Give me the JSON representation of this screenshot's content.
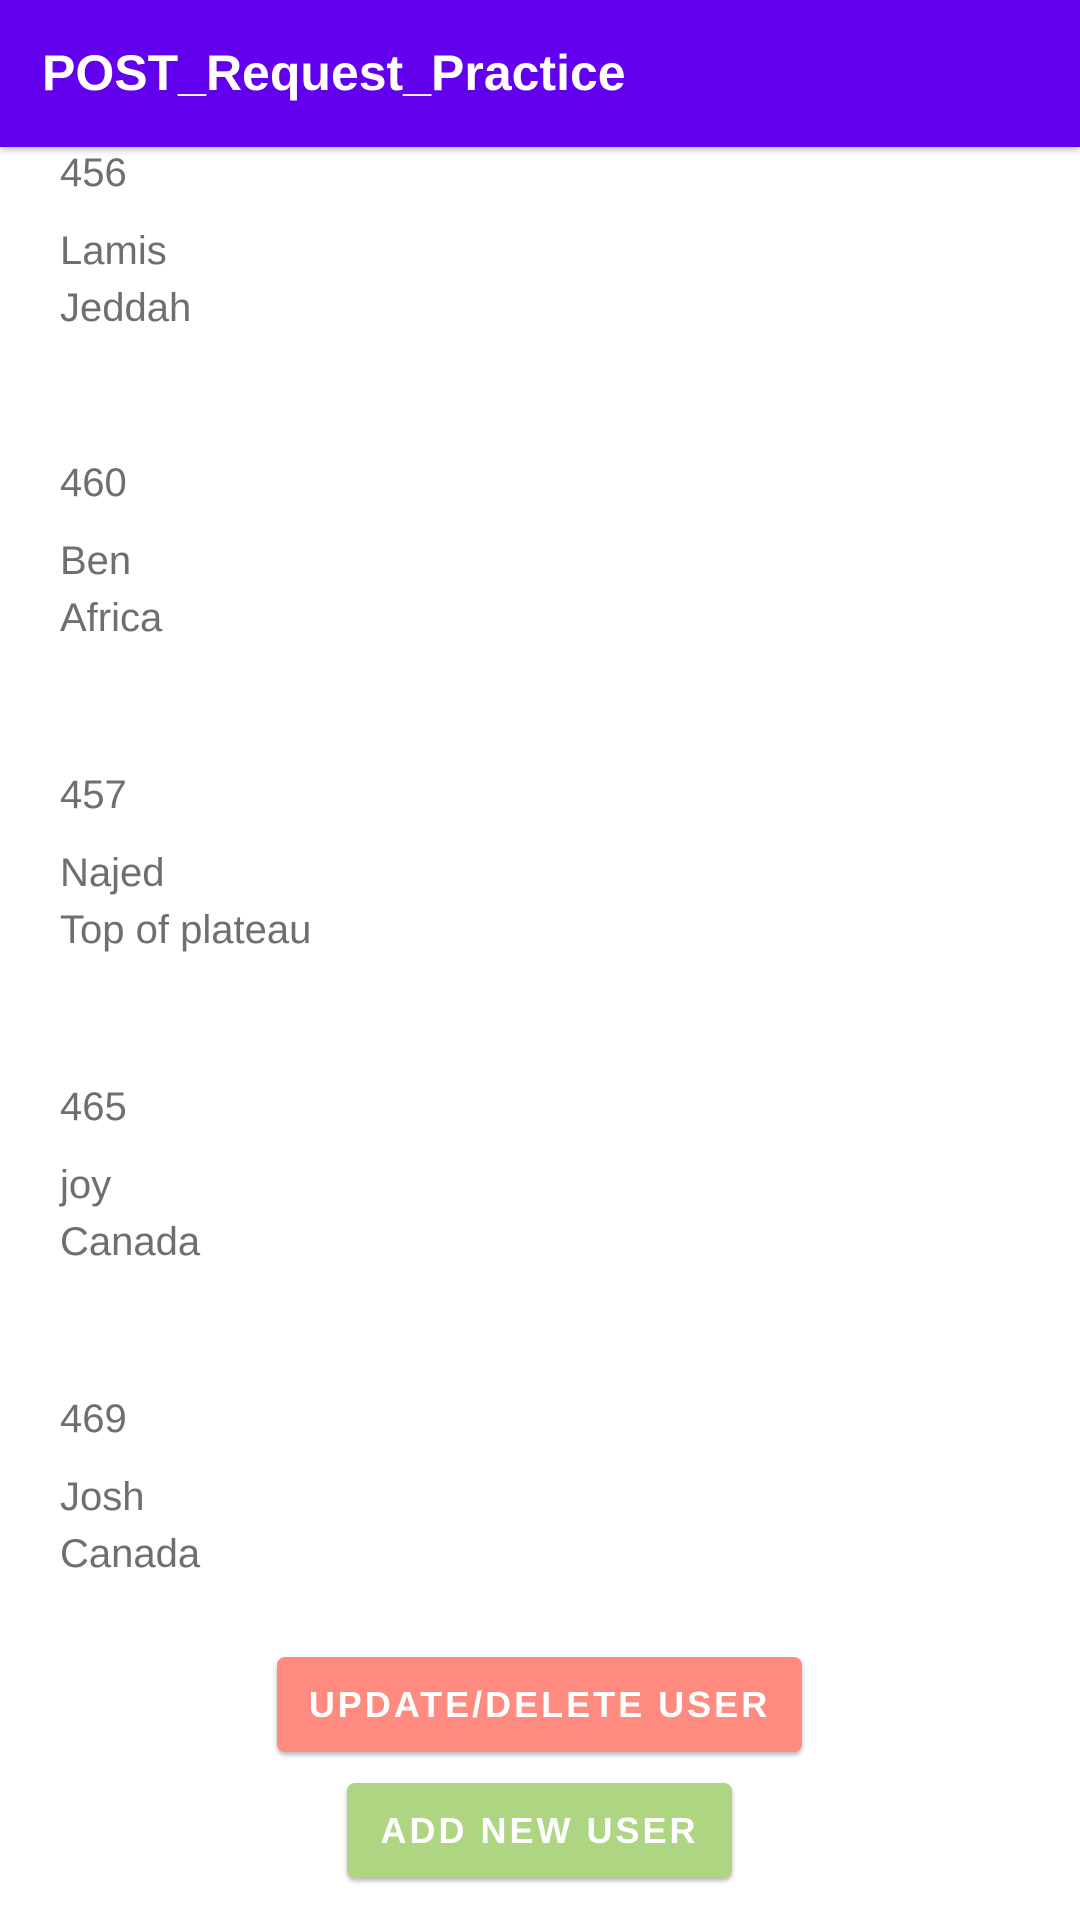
{
  "app_bar": {
    "title": "POST_Request_Practice",
    "color": "#6200EE"
  },
  "users": [
    {
      "id": "456",
      "name": "Lamis",
      "location": "Jeddah"
    },
    {
      "id": "460",
      "name": "Ben",
      "location": "Africa"
    },
    {
      "id": "457",
      "name": "Najed",
      "location": "Top of plateau"
    },
    {
      "id": "465",
      "name": "joy",
      "location": "Canada"
    },
    {
      "id": "469",
      "name": "Josh",
      "location": "Canada"
    }
  ],
  "buttons": {
    "update_delete_label": "UPDATE/DELETE USER",
    "update_delete_color": "#FF8A80",
    "add_new_label": "ADD NEW USER",
    "add_new_color": "#AED581"
  }
}
